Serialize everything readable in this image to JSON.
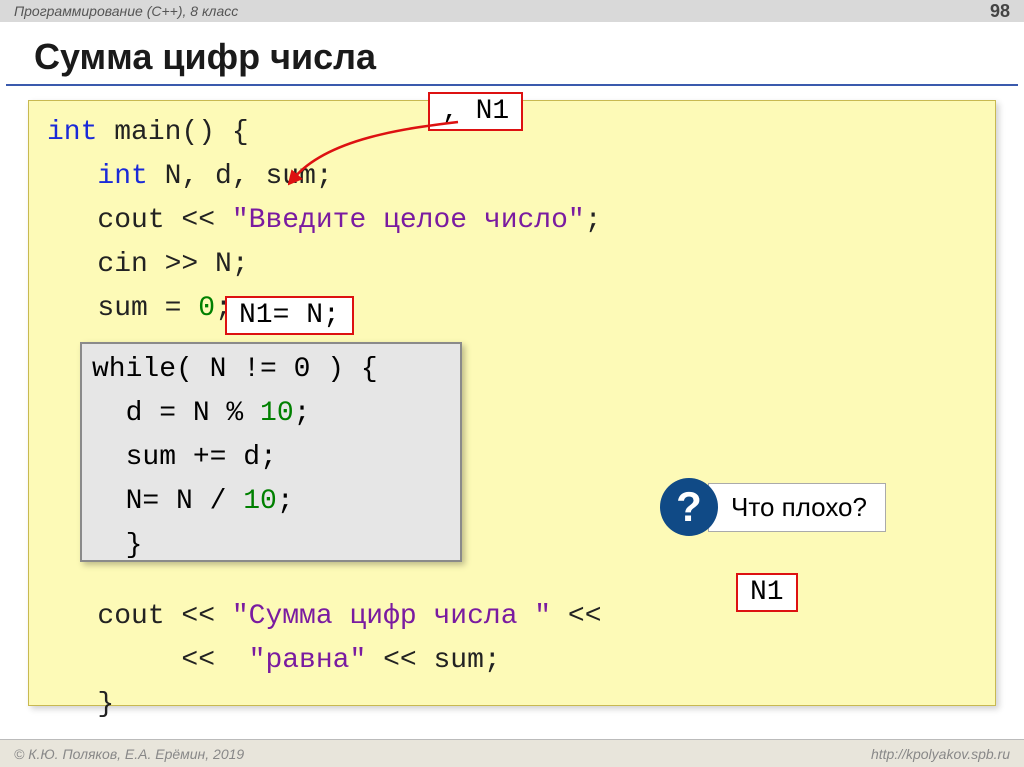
{
  "header": {
    "course": "Программирование (C++), 8 класс",
    "page_no": "98"
  },
  "title": "Сумма цифр числа",
  "callouts": {
    "top": ", N1",
    "mid": "N1= N;",
    "bottom": "N1"
  },
  "question": {
    "mark": "?",
    "text": "Что плохо?"
  },
  "code": {
    "l1a": "int",
    "l1b": " main() {",
    "l2a": "int",
    "l2b": " N, d, sum;",
    "l3a": "   cout << ",
    "l3b": "\"Введите целое число\"",
    "l3c": ";",
    "l4": "   cin >> N;",
    "l5a": "   sum = ",
    "l5b": "0",
    "l5c": ";",
    "wh1": "while( N != 0 ) {",
    "wh2a": "  d = N % ",
    "wh2b": "10",
    "wh2c": ";",
    "wh3": "  sum += d;",
    "wh4a": "  N= N / ",
    "wh4b": "10",
    "wh4c": ";",
    "wh5": "  }",
    "l6a": "   cout << ",
    "l6b": "\"Сумма цифр числа \"",
    "l6c": " <<",
    "l7a": "        << ",
    "l7b": " \"равна\"",
    "l7c": " << sum;",
    "l8": "   }"
  },
  "footer": {
    "left": "© К.Ю. Поляков, Е.А. Ерёмин, 2019",
    "right": "http://kpolyakov.spb.ru"
  }
}
